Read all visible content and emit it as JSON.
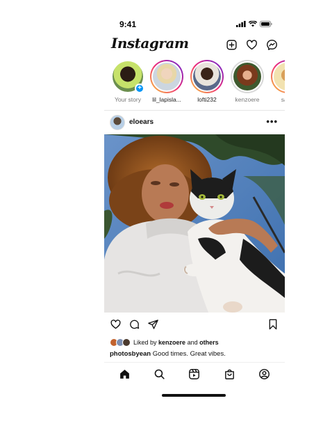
{
  "status_bar": {
    "time": "9:41"
  },
  "header": {
    "logo": "Instagram",
    "icons": [
      "new-post-icon",
      "heart-icon",
      "messenger-icon"
    ]
  },
  "stories": [
    {
      "label": "Your story",
      "own": true
    },
    {
      "label": "lil_lapisla..."
    },
    {
      "label": "lofti232"
    },
    {
      "label": "kenzoere"
    },
    {
      "label": "sapp"
    }
  ],
  "post": {
    "username": "eloears",
    "more": "•••",
    "liked_prefix": "Liked by",
    "liked_user": "kenzoere",
    "liked_and": "and",
    "liked_others": "others",
    "caption_user": "photosbyean",
    "caption_text": "Good times. Great vibes."
  },
  "bottom_nav": [
    "home-icon",
    "search-icon",
    "reels-icon",
    "shop-icon",
    "profile-icon"
  ],
  "colors": {
    "accent": "#0095f6",
    "story_ring_start": "#f9ce34",
    "story_ring_mid": "#ee2a7b",
    "story_ring_end": "#6228d7"
  }
}
